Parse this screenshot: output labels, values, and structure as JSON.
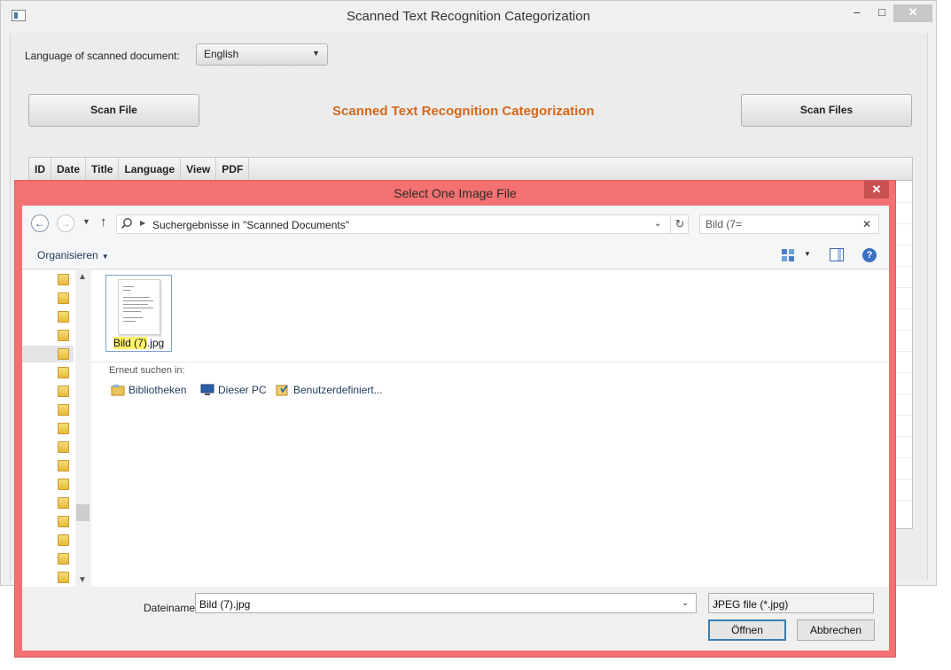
{
  "main_window": {
    "title": "Scanned Text Recognition Categorization",
    "minimize_glyph": "–",
    "maximize_glyph": "□",
    "close_glyph": "✕",
    "language_label": "Language of scanned document:",
    "language_value": "English",
    "scan_file_label": "Scan File",
    "scan_files_label": "Scan Files",
    "heading": "Scanned Text Recognition Categorization",
    "heading_color": "#d2691e",
    "table_columns": [
      "ID",
      "Date",
      "Title",
      "Language",
      "View",
      "PDF"
    ]
  },
  "dialog": {
    "title": "Select One Image File",
    "title_bar_color": "#f37171",
    "close_glyph": "✕",
    "address_text": "Suchergebnisse in \"Scanned Documents\"",
    "search_value": "Bild (7=",
    "organize_label": "Organisieren",
    "file": {
      "name_highlight": "Bild (7)",
      "name_rest": ".jpg"
    },
    "retry_label": "Erneut suchen in:",
    "locations": [
      "Bibliotheken",
      "Dieser PC",
      "Benutzerdefiniert..."
    ],
    "filename_label": "Dateiname:",
    "filename_value": "Bild (7).jpg",
    "filetype_value": "JPEG file (*.jpg)",
    "open_label": "Öffnen",
    "cancel_label": "Abbrechen"
  },
  "icons": [
    "app-icon",
    "back-icon",
    "forward-icon",
    "up-icon",
    "search-icon",
    "refresh-icon",
    "clear-icon",
    "view-icon",
    "preview-pane-icon",
    "help-icon",
    "folder-icon",
    "library-icon",
    "computer-icon",
    "custom-folder-icon"
  ]
}
